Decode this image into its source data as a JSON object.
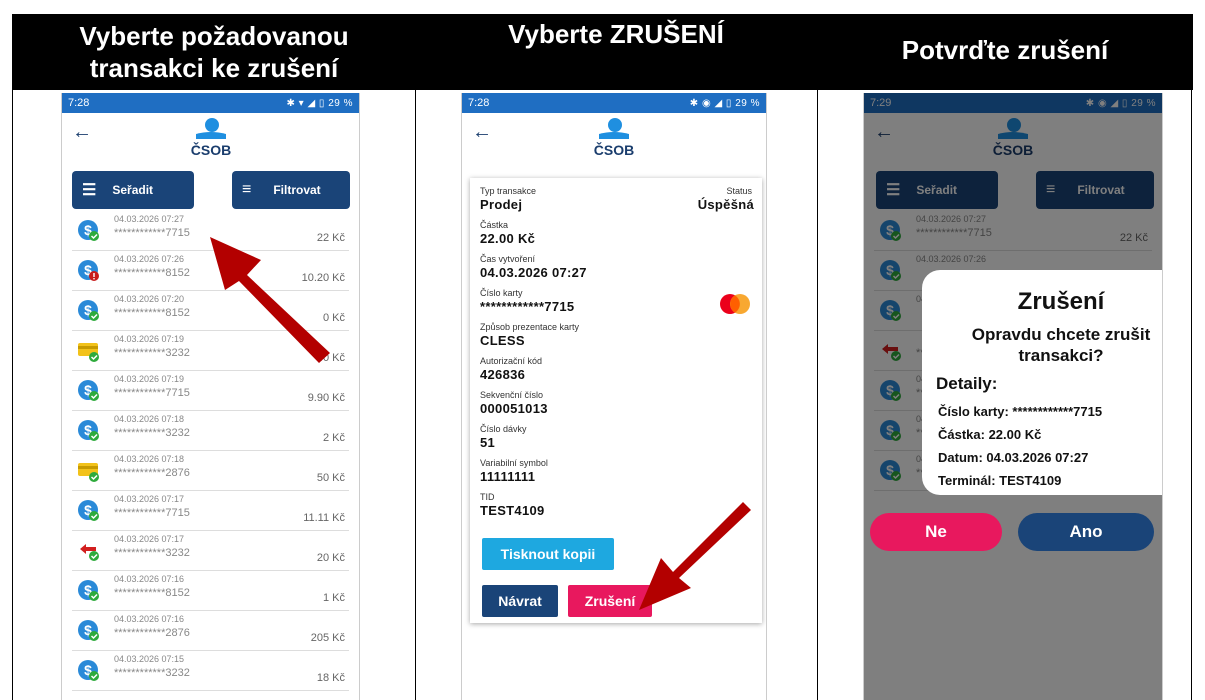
{
  "headers": [
    "Vyberte požadovanou transakci ke zrušení",
    "Vyberte ZRUŠENÍ",
    "Potvrďte zrušení"
  ],
  "screen1": {
    "time": "7:28",
    "status_icons": "✱ ▾ ◢ ▯ 29 %",
    "sort_label": "Seřadit",
    "filter_label": "Filtrovat",
    "rows": [
      {
        "date": "04.03.2026 07:27",
        "card": "************7715",
        "amount": "22 Kč",
        "icon": "card-ok"
      },
      {
        "date": "04.03.2026 07:26",
        "card": "************8152",
        "amount": "10.20 Kč",
        "icon": "card-error"
      },
      {
        "date": "04.03.2026 07:20",
        "card": "************8152",
        "amount": "0 Kč",
        "icon": "card-ok"
      },
      {
        "date": "04.03.2026 07:19",
        "card": "************3232",
        "amount": "40 Kč",
        "icon": "yellow-card"
      },
      {
        "date": "04.03.2026 07:19",
        "card": "************7715",
        "amount": "9.90 Kč",
        "icon": "card-ok"
      },
      {
        "date": "04.03.2026 07:18",
        "card": "************3232",
        "amount": "2 Kč",
        "icon": "card-ok"
      },
      {
        "date": "04.03.2026 07:18",
        "card": "************2876",
        "amount": "50 Kč",
        "icon": "yellow-card"
      },
      {
        "date": "04.03.2026 07:17",
        "card": "************7715",
        "amount": "11.11 Kč",
        "icon": "card-ok"
      },
      {
        "date": "04.03.2026 07:17",
        "card": "************3232",
        "amount": "20 Kč",
        "icon": "refund"
      },
      {
        "date": "04.03.2026 07:16",
        "card": "************8152",
        "amount": "1 Kč",
        "icon": "card-ok"
      },
      {
        "date": "04.03.2026 07:16",
        "card": "************2876",
        "amount": "205 Kč",
        "icon": "card-ok"
      },
      {
        "date": "04.03.2026 07:15",
        "card": "************3232",
        "amount": "18 Kč",
        "icon": "card-ok"
      }
    ]
  },
  "screen2": {
    "time": "7:28",
    "status_icons": "✱ ◉ ◢ ▯ 29 %",
    "type_label": "Typ transakce",
    "type_value": "Prodej",
    "status_label": "Status",
    "status_value": "Úspěšná",
    "amount_label": "Částka",
    "amount_value": "22.00 Kč",
    "created_label": "Čas vytvoření",
    "created_value": "04.03.2026 07:27",
    "card_label": "Číslo karty",
    "card_value": "************7715",
    "method_label": "Způsob prezentace karty",
    "method_value": "CLESS",
    "auth_label": "Autorizační kód",
    "auth_value": "426836",
    "seq_label": "Sekvenční číslo",
    "seq_value": "000051013",
    "batch_label": "Číslo dávky",
    "batch_value": "51",
    "vs_label": "Variabilní symbol",
    "vs_value": "11111111",
    "tid_label": "TID",
    "tid_value": "TEST4109",
    "print_label": "Tisknout kopii",
    "back_label": "Návrat",
    "cancel_label": "Zrušení"
  },
  "screen3": {
    "time": "7:29",
    "status_icons": "✱ ◉ ◢ ▯ 29 %",
    "sort_label": "Seřadit",
    "filter_label": "Filtrovat",
    "dialog_title": "Zrušení",
    "dialog_question": "Opravdu chcete zrušit transakci?",
    "details_label": "Detaily:",
    "detail_card": "Číslo karty: ************7715",
    "detail_amount": "Částka: 22.00 Kč",
    "detail_date": "Datum: 04.03.2026 07:27",
    "detail_terminal": "Terminál: TEST4109",
    "no_label": "Ne",
    "yes_label": "Ano",
    "rows": [
      {
        "date": "04.03.2026 07:27",
        "card": "************7715",
        "amount": "22 Kč",
        "icon": "card-ok"
      },
      {
        "date": "04.03.2026 07:26",
        "card": "",
        "amount": "",
        "icon": "card-ok"
      },
      {
        "date": "04.03.2026 07:17",
        "card": "",
        "amount": "",
        "icon": "card-ok"
      },
      {
        "date": "",
        "card": "************3232",
        "amount": "20 Kč",
        "icon": "refund"
      },
      {
        "date": "04.03.2026 07:16",
        "card": "************8152",
        "amount": "1 Kč",
        "icon": "card-ok"
      },
      {
        "date": "04.03.2026 07:16",
        "card": "************2876",
        "amount": "205 Kč",
        "icon": "card-ok"
      },
      {
        "date": "04.03.2026 07:15",
        "card": "************3232",
        "amount": "18 Kč",
        "icon": "card-ok"
      }
    ]
  },
  "colors": {
    "blue": "#1a4478",
    "statusbar": "#1f6ec2",
    "pink": "#e8185e",
    "cyan": "#1ea8e0",
    "arrow": "#b30000",
    "icon_blue": "#2a8ad8",
    "ok_green": "#2eaa3c"
  }
}
